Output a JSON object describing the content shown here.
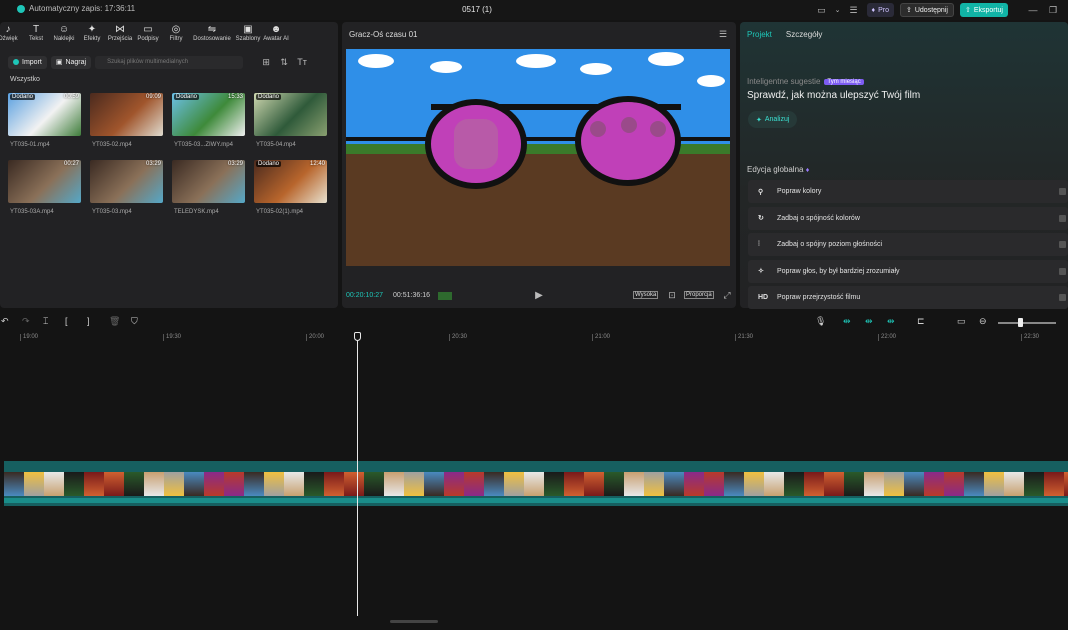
{
  "titlebar": {
    "autosave": "Automatyczny zapis: 17:36:11",
    "project_title": "0517 (1)",
    "pro_label": "Pro",
    "share_label": "Udostępnij",
    "export_label": "Eksportuj"
  },
  "toolbar": {
    "items": [
      {
        "label": "Dźwięk",
        "icon": "music-note-icon",
        "glyph": "♪"
      },
      {
        "label": "Tekst",
        "icon": "text-icon",
        "glyph": "T"
      },
      {
        "label": "Naklejki",
        "icon": "sticker-icon",
        "glyph": "☺"
      },
      {
        "label": "Efekty",
        "icon": "sparkle-icon",
        "glyph": "✦"
      },
      {
        "label": "Przejścia",
        "icon": "transition-icon",
        "glyph": "⋈"
      },
      {
        "label": "Podpisy",
        "icon": "captions-icon",
        "glyph": "▭"
      },
      {
        "label": "Filtry",
        "icon": "filters-icon",
        "glyph": "◎"
      },
      {
        "label": "Dostosowanie",
        "icon": "adjust-icon",
        "glyph": "⇋"
      },
      {
        "label": "Szablony",
        "icon": "templates-icon",
        "glyph": "▣"
      },
      {
        "label": "Awatar AI",
        "icon": "avatar-icon",
        "glyph": "☻"
      }
    ]
  },
  "media": {
    "import_label": "Import",
    "record_label": "Nagraj",
    "search_placeholder": "Szukaj plików multimedialnych",
    "filter_label": "Wszystko",
    "items": [
      {
        "name": "YT035-01.mp4",
        "duration": "00:59",
        "badge": "Dodano",
        "colors": [
          "#5aa0e0",
          "#f2f2f2",
          "#3e7d3a"
        ]
      },
      {
        "name": "YT035-02.mp4",
        "duration": "09:09",
        "badge": "",
        "colors": [
          "#4b2a1e",
          "#a0552c",
          "#e0dcd0"
        ]
      },
      {
        "name": "YT035-03...ZIWY.mp4",
        "duration": "15:33",
        "badge": "Dodano",
        "colors": [
          "#6cc0e8",
          "#3e8a3a",
          "#f0f0f0"
        ]
      },
      {
        "name": "YT035-04.mp4",
        "duration": "",
        "badge": "Dodano",
        "colors": [
          "#cfd8b0",
          "#2f5a3a",
          "#8aa070"
        ]
      },
      {
        "name": "YT035-03A.mp4",
        "duration": "00:27",
        "badge": "",
        "colors": [
          "#3a2a22",
          "#8a7058",
          "#55a8c8"
        ]
      },
      {
        "name": "YT035-03.mp4",
        "duration": "03:29",
        "badge": "",
        "colors": [
          "#3a2a22",
          "#8a7058",
          "#55a8c8"
        ]
      },
      {
        "name": "TELEDYSK.mp4",
        "duration": "03:29",
        "badge": "",
        "colors": [
          "#3a2a22",
          "#8a7058",
          "#55a8c8"
        ]
      },
      {
        "name": "YT035-02(1).mp4",
        "duration": "12:40",
        "badge": "Dodano",
        "colors": [
          "#4b2a1e",
          "#b8652c",
          "#e8e2d0"
        ]
      }
    ]
  },
  "player": {
    "title": "Gracz-Oś czasu 01",
    "current_time": "00:20:10:27",
    "total_time": "00:51:36:16",
    "quality_label": "Wysoka",
    "ratio_label": "Proporcja"
  },
  "inspector": {
    "tab_project": "Projekt",
    "tab_details": "Szczegóły",
    "suggest_label": "Inteligentne sugestie",
    "hot_badge": "Tym miesiąc",
    "suggest_title": "Sprawdź, jak można ulepszyć Twój film",
    "analyze_label": "Analizuj",
    "global_title": "Edycja globalna",
    "items": [
      {
        "label": "Popraw kolory",
        "icon": "magic-wand-icon",
        "glyph": "⚲"
      },
      {
        "label": "Zadbaj o spójność kolorów",
        "icon": "color-match-icon",
        "glyph": "↻"
      },
      {
        "label": "Zadbaj o spójny poziom głośności",
        "icon": "volume-levels-icon",
        "glyph": "⫶"
      },
      {
        "label": "Popraw głos, by był bardziej zrozumiały",
        "icon": "voice-enhance-icon",
        "glyph": "✧"
      },
      {
        "label": "Popraw przejrzystość filmu",
        "icon": "hd-icon",
        "glyph": "HD"
      }
    ]
  },
  "timeline": {
    "ruler": [
      "19:00",
      "19:30",
      "20:00",
      "20:30",
      "21:00",
      "21:30",
      "22:00",
      "22:30"
    ]
  }
}
